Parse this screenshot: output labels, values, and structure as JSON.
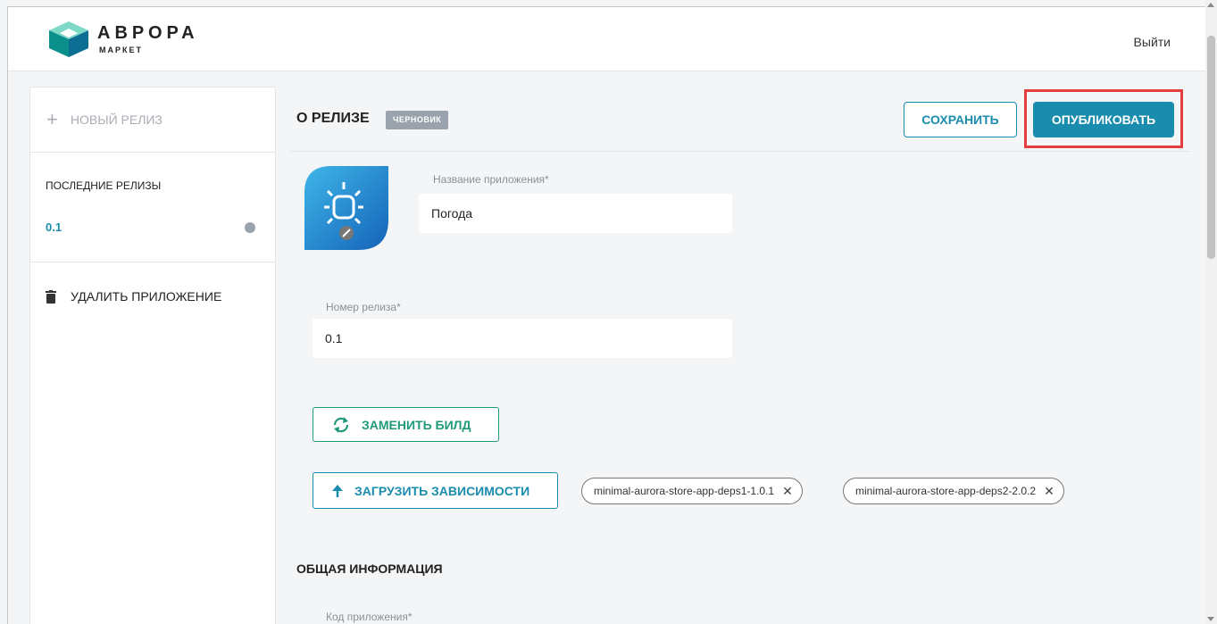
{
  "header": {
    "brand_title": "АВРОРА",
    "brand_subtitle": "МАРКЕТ",
    "logout_label": "Выйти"
  },
  "sidebar": {
    "new_release_label": "НОВЫЙ РЕЛИЗ",
    "recent_title": "ПОСЛЕДНИЕ РЕЛИЗЫ",
    "releases": [
      {
        "version": "0.1"
      }
    ],
    "delete_label": "УДАЛИТЬ ПРИЛОЖЕНИЕ"
  },
  "main": {
    "title": "О РЕЛИЗЕ",
    "badge": "ЧЕРНОВИК",
    "save_label": "СОХРАНИТЬ",
    "publish_label": "ОПУБЛИКОВАТЬ",
    "app_name_label": "Название приложения*",
    "app_name_value": "Погода",
    "release_number_label": "Номер релиза*",
    "release_number_value": "0.1",
    "replace_build_label": "ЗАМЕНИТЬ БИЛД",
    "upload_deps_label": "ЗАГРУЗИТЬ ЗАВИСИМОСТИ",
    "dependencies": [
      {
        "name": "minimal-aurora-store-app-deps1-1.0.1"
      },
      {
        "name": "minimal-aurora-store-app-deps2-2.0.2"
      }
    ],
    "general_info_title": "ОБЩАЯ ИНФОРМАЦИЯ",
    "app_code_label": "Код приложения*"
  },
  "colors": {
    "accent": "#1a8cae",
    "green": "#1e9a7a",
    "highlight": "#e53c3c",
    "badge": "#9aa3ad"
  }
}
